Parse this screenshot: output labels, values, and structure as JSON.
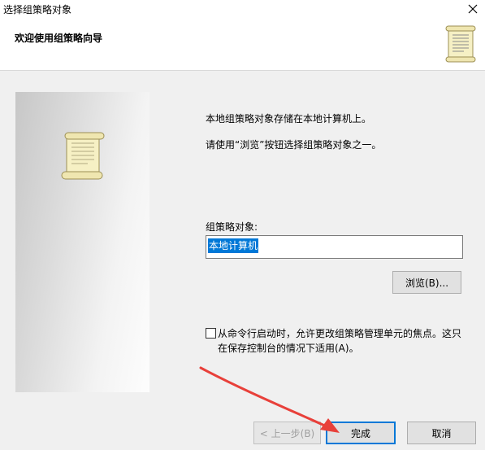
{
  "window": {
    "title": "选择组策略对象"
  },
  "header": {
    "title": "欢迎使用组策略向导"
  },
  "content": {
    "line1": "本地组策略对象存储在本地计算机上。",
    "line2": "请使用“浏览”按钮选择组策略对象之一。",
    "gpo_label": "组策略对象:",
    "gpo_value": "本地计算机",
    "browse_label": "浏览(B)...",
    "checkbox_line1": "从命令行启动时，允许更改组策略管理单元的焦点。这只",
    "checkbox_line2": "在保存控制台的情况下适用(A)。",
    "checkbox_checked": false
  },
  "footer": {
    "back_label": "< 上一步(B)",
    "finish_label": "完成",
    "cancel_label": "取消"
  },
  "colors": {
    "accent": "#0078d7",
    "annotation_arrow": "#e8403a",
    "scroll_paper": "#f6f0c4"
  },
  "icons": {
    "close": "close-icon",
    "header_scroll": "scroll-icon",
    "panel_scroll": "scroll-icon"
  }
}
